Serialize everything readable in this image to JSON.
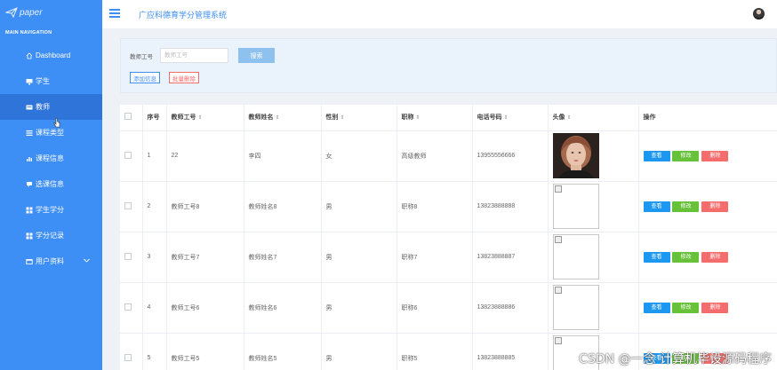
{
  "app": {
    "logo_text": "paper",
    "title": "广应科德育学分管理系统"
  },
  "sidebar": {
    "heading": "MAIN NAVIGATION",
    "items": [
      {
        "label": "Dashboard",
        "icon": "home-icon"
      },
      {
        "label": "学生",
        "icon": "monitor-icon"
      },
      {
        "label": "教师",
        "icon": "card-icon",
        "active": true
      },
      {
        "label": "课程类型",
        "icon": "list-icon"
      },
      {
        "label": "课程信息",
        "icon": "bar-chart-icon"
      },
      {
        "label": "选课信息",
        "icon": "comment-icon"
      },
      {
        "label": "学生学分",
        "icon": "grid-icon"
      },
      {
        "label": "学分记录",
        "icon": "grid-icon"
      },
      {
        "label": "用户资料",
        "icon": "wallet-icon",
        "chevron": true
      }
    ]
  },
  "search": {
    "label": "教师工号",
    "placeholder": "教师工号",
    "search_button": "搜索",
    "add_button": "添加信息",
    "batch_delete_button": "批量删除"
  },
  "table": {
    "columns": [
      "序号",
      "教师工号",
      "教师姓名",
      "性别",
      "职称",
      "电话号码",
      "头像",
      "操作"
    ],
    "rows": [
      {
        "index": "1",
        "id": "22",
        "name": "李四",
        "gender": "女",
        "title": "高级教师",
        "phone": "13955556666",
        "avatar": "photo"
      },
      {
        "index": "2",
        "id": "教师工号8",
        "name": "教师姓名8",
        "gender": "男",
        "title": "职称8",
        "phone": "13823888888",
        "avatar": "broken"
      },
      {
        "index": "3",
        "id": "教师工号7",
        "name": "教师姓名7",
        "gender": "男",
        "title": "职称7",
        "phone": "13823888887",
        "avatar": "broken"
      },
      {
        "index": "4",
        "id": "教师工号6",
        "name": "教师姓名6",
        "gender": "男",
        "title": "职称6",
        "phone": "13823888886",
        "avatar": "broken"
      },
      {
        "index": "5",
        "id": "教师工号5",
        "name": "教师姓名5",
        "gender": "男",
        "title": "职称5",
        "phone": "13823888885",
        "avatar": "broken"
      }
    ],
    "actions": {
      "view": "查看",
      "edit": "修改",
      "delete": "删除"
    }
  },
  "watermark": "CSDN @一念 计算机毕设源码程序",
  "colors": {
    "sidebar": "#3d8ef5",
    "view": "#1d98f0",
    "edit": "#67c23a",
    "delete": "#f56c6c"
  }
}
